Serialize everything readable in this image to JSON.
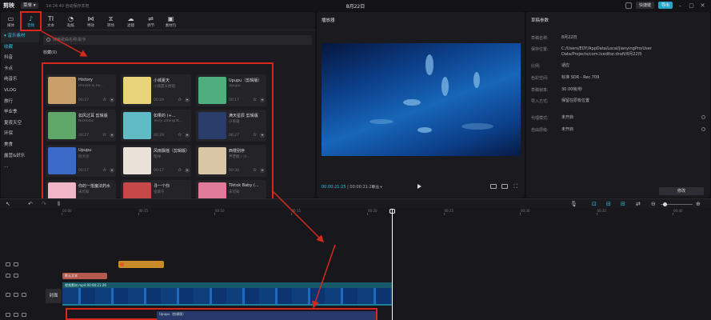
{
  "titlebar": {
    "logo": "剪映",
    "menu": "菜单 ▾",
    "autosave": "14:24:40 自动保存本地",
    "project_title": "8月22日",
    "shortcut": "快捷键",
    "export": "导出"
  },
  "toolbar": [
    {
      "label": "媒体",
      "icon": "▭"
    },
    {
      "label": "音频",
      "icon": "♪"
    },
    {
      "label": "文本",
      "icon": "TI"
    },
    {
      "label": "贴纸",
      "icon": "◔"
    },
    {
      "label": "特效",
      "icon": "⋈"
    },
    {
      "label": "转场",
      "icon": "⧖"
    },
    {
      "label": "滤镜",
      "icon": "☁"
    },
    {
      "label": "调节",
      "icon": "⇌"
    },
    {
      "label": "素材包",
      "icon": "▣"
    }
  ],
  "sidebar": [
    {
      "label": "▾ 音乐素材"
    },
    {
      "label": "收藏"
    },
    {
      "label": "抖音"
    },
    {
      "label": "卡点"
    },
    {
      "label": "纯音乐"
    },
    {
      "label": "VLOG"
    },
    {
      "label": "旅行"
    },
    {
      "label": "毕业季"
    },
    {
      "label": "夏夜天空"
    },
    {
      "label": "环保"
    },
    {
      "label": "美食"
    },
    {
      "label": "露营&好乐"
    },
    {
      "label": "..."
    }
  ],
  "search": {
    "placeholder": "搜索歌曲名称/歌手"
  },
  "favorites_title": "收藏(0)",
  "music_group": "抖音",
  "songs": [
    {
      "title": "History",
      "artist": "Rhivon & Ru...",
      "duration": "00:27",
      "color": "#c9a06a"
    },
    {
      "title": "小城夏天",
      "artist": "小城夏天原唱",
      "duration": "00:29",
      "color": "#e8d27a"
    },
    {
      "title": "Upupu（剪辑版）",
      "artist": "Upupu",
      "duration": "00:17",
      "color": "#4fae7e"
    },
    {
      "title": "如风过耳 剪辑版",
      "artist": "Nicholas",
      "duration": "00:27",
      "color": "#5fa86a"
    },
    {
      "title": "如果的 (+...",
      "artist": "Terry Zhong N...",
      "duration": "00:29",
      "color": "#5fbcc6"
    },
    {
      "title": "满天星辰 剪辑版",
      "artist": "小英雄",
      "duration": "00:27",
      "color": "#2a3d6a"
    },
    {
      "title": "Upupu",
      "artist": "阿大亭",
      "duration": "00:17",
      "color": "#3a6ac8"
    },
    {
      "title": "风雨飘摇（剪辑版）",
      "artist": "暗绿",
      "duration": "00:17",
      "color": "#e9e2d8"
    },
    {
      "title": "西楼别序",
      "artist": "尹昔眠 / 小...",
      "duration": "00:30",
      "color": "#d9c6a6"
    },
    {
      "title": "你的一抵魔法药水",
      "artist": "未可知",
      "duration": "00:27",
      "color": "#f0b6c8"
    },
    {
      "title": "寻一个你",
      "artist": "张紫宁",
      "duration": "00:29",
      "color": "#c64848"
    },
    {
      "title": "Tiktok Baby (...",
      "artist": "未可知",
      "duration": "00:29",
      "color": "#e07a9a"
    }
  ],
  "player": {
    "title": "播放器",
    "current": "00:00:21:25",
    "total": "00:00:21:26",
    "quality": "原画 ▾"
  },
  "params": {
    "title": "草稿参数",
    "rows": [
      {
        "key": "草稿名称:",
        "value": "8月22日"
      },
      {
        "key": "保存位置:",
        "value": "C:/Users/EDY/AppData/Local/JianyingPro/User Data/Projects/com.lveditor.draft/8月22日"
      },
      {
        "key": "比例:",
        "value": "适应"
      },
      {
        "key": "色彩空间:",
        "value": "标准 SDR - Rec.709"
      },
      {
        "key": "草稿帧率:",
        "value": "30.00帧/秒"
      },
      {
        "key": "导入方式:",
        "value": "保留在原有位置"
      },
      {
        "key": "代理模式:",
        "value": "未开启"
      },
      {
        "key": "自由层级:",
        "value": "未开启"
      }
    ],
    "edit": "修改"
  },
  "timeline": {
    "ticks": [
      "00:00",
      "00:15",
      "00:10",
      "00:15",
      "00:20",
      "00:25",
      "00:30",
      "00:35",
      "00:40"
    ],
    "text_clip": "默认文本",
    "video_clip": "视频素材.mp4   00:00:21:26",
    "cover": "封面",
    "audio_clip": "Upupu（剪辑版）"
  },
  "colors": {
    "accent": "#2ec5e0",
    "highlight": "#d8281e"
  }
}
